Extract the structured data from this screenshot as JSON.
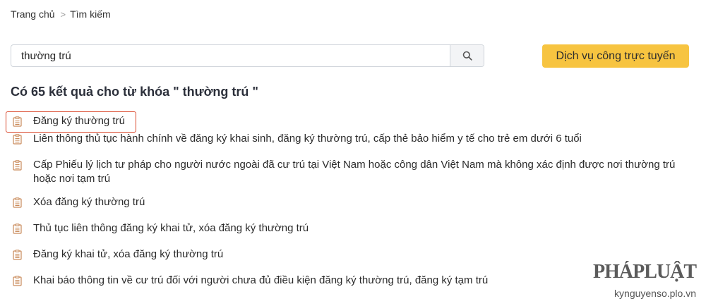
{
  "breadcrumb": {
    "home": "Trang chủ",
    "separator": ">",
    "current": "Tìm kiếm"
  },
  "search": {
    "value": "thường trú",
    "icon": "search-icon"
  },
  "cta": {
    "label": "Dịch vụ công trực tuyến",
    "color": "#f7c440"
  },
  "results_heading": "Có 65 kết quả cho từ khóa \" thường trú \"",
  "results": [
    {
      "title": "Đăng ký thường trú",
      "icon": "document-icon"
    },
    {
      "title": "Liên thông thủ tục hành chính về đăng ký khai sinh, đăng ký thường trú, cấp thẻ bảo hiểm y tế cho trẻ em dưới 6 tuổi",
      "icon": "document-icon"
    },
    {
      "title": "Cấp Phiếu lý lịch tư pháp cho người nước ngoài đã cư trú tại Việt Nam hoặc công dân Việt Nam mà không xác định được nơi thường trú hoặc nơi tạm trú",
      "icon": "document-icon"
    },
    {
      "title": "Xóa đăng ký thường trú",
      "icon": "document-icon"
    },
    {
      "title": "Thủ tục liên thông đăng ký khai tử, xóa đăng ký thường trú",
      "icon": "document-icon"
    },
    {
      "title": "Đăng ký khai tử, xóa đăng ký thường trú",
      "icon": "document-icon"
    },
    {
      "title": "Khai báo thông tin về cư trú đối với người chưa đủ điều kiện đăng ký thường trú, đăng ký tạm trú",
      "icon": "document-icon"
    }
  ],
  "highlight_color": "#d9472b",
  "icon_color": "#c98a5a",
  "watermark": {
    "logo": "PHÁPLUẬT",
    "url": "kynguyenso.plo.vn"
  }
}
